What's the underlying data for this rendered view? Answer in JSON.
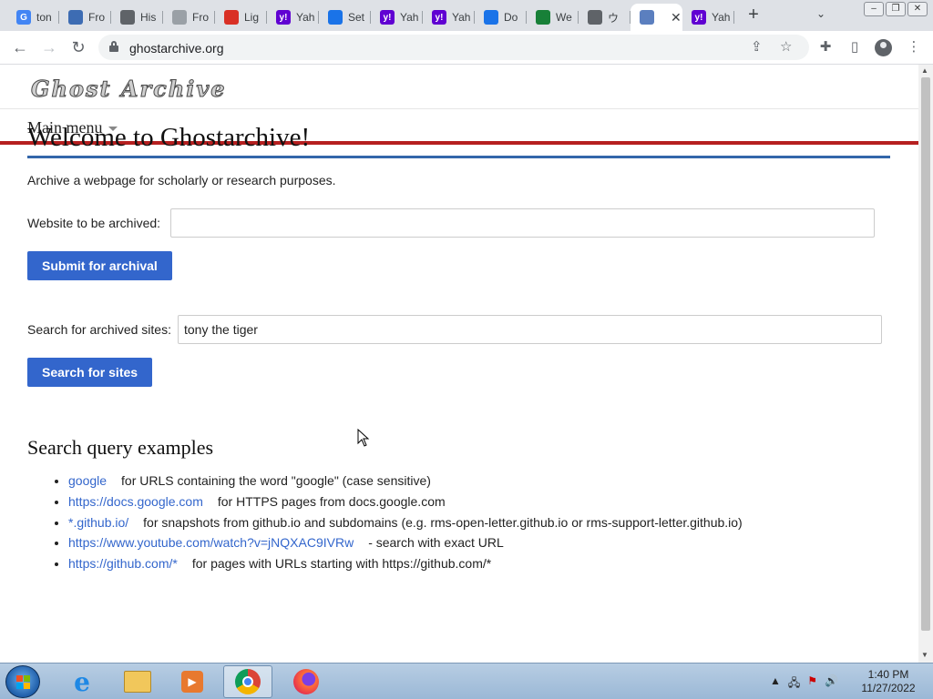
{
  "browser": {
    "tabs": [
      {
        "label": "ton",
        "icon": "google-icon",
        "color": "#4285f4",
        "glyph": "G"
      },
      {
        "label": "Fro",
        "icon": "book-icon",
        "color": "#3d6cb3",
        "glyph": ""
      },
      {
        "label": "His",
        "icon": "globe-icon",
        "color": "#5f6368",
        "glyph": ""
      },
      {
        "label": "Fro",
        "icon": "shirt-icon",
        "color": "#9aa0a6",
        "glyph": ""
      },
      {
        "label": "Lig",
        "icon": "chart-icon",
        "color": "#d93025",
        "glyph": ""
      },
      {
        "label": "Yah",
        "icon": "yahoo-icon",
        "color": "#6001d2",
        "glyph": "y!"
      },
      {
        "label": "Set",
        "icon": "gear-icon",
        "color": "#1a73e8",
        "glyph": ""
      },
      {
        "label": "Yah",
        "icon": "yahoo-icon",
        "color": "#6001d2",
        "glyph": "y!"
      },
      {
        "label": "Yah",
        "icon": "yahoo-icon",
        "color": "#6001d2",
        "glyph": "y!"
      },
      {
        "label": "Do",
        "icon": "download-icon",
        "color": "#1a73e8",
        "glyph": ""
      },
      {
        "label": "We",
        "icon": "spreadsheet-icon",
        "color": "#188038",
        "glyph": ""
      },
      {
        "label": "ウ",
        "icon": "rainbow-icon",
        "color": "#5f6368",
        "glyph": ""
      },
      {
        "label": "",
        "icon": "ghost-archive-icon",
        "color": "#5b7fbf",
        "glyph": "",
        "active": true
      },
      {
        "label": "Yah",
        "icon": "yahoo-icon",
        "color": "#6001d2",
        "glyph": "y!"
      }
    ],
    "url": "ghostarchive.org"
  },
  "site": {
    "logo_text": "Ghost Archive",
    "menu_label": "Main menu",
    "heading": "Welcome to Ghostarchive!",
    "intro": "Archive a webpage for scholarly or research purposes.",
    "archive_label": "Website to be archived:",
    "archive_value": "",
    "archive_button": "Submit for archival",
    "search_label": "Search for archived sites:",
    "search_value": "tony the tiger",
    "search_button": "Search for sites",
    "examples_heading": "Search query examples",
    "examples": [
      {
        "link": "google",
        "desc": "for URLS containing the word \"google\" (case sensitive)"
      },
      {
        "link": "https://docs.google.com",
        "desc": "for HTTPS pages from docs.google.com"
      },
      {
        "link": "*.github.io/",
        "desc": "for snapshots from github.io and subdomains (e.g. rms-open-letter.github.io or rms-support-letter.github.io)"
      },
      {
        "link": "https://www.youtube.com/watch?v=jNQXAC9IVRw",
        "desc": "- search with exact URL"
      },
      {
        "link": "https://github.com/*",
        "desc": "for pages with URLs starting with https://github.com/*"
      }
    ]
  },
  "taskbar": {
    "time": "1:40 PM",
    "date": "11/27/2022"
  }
}
